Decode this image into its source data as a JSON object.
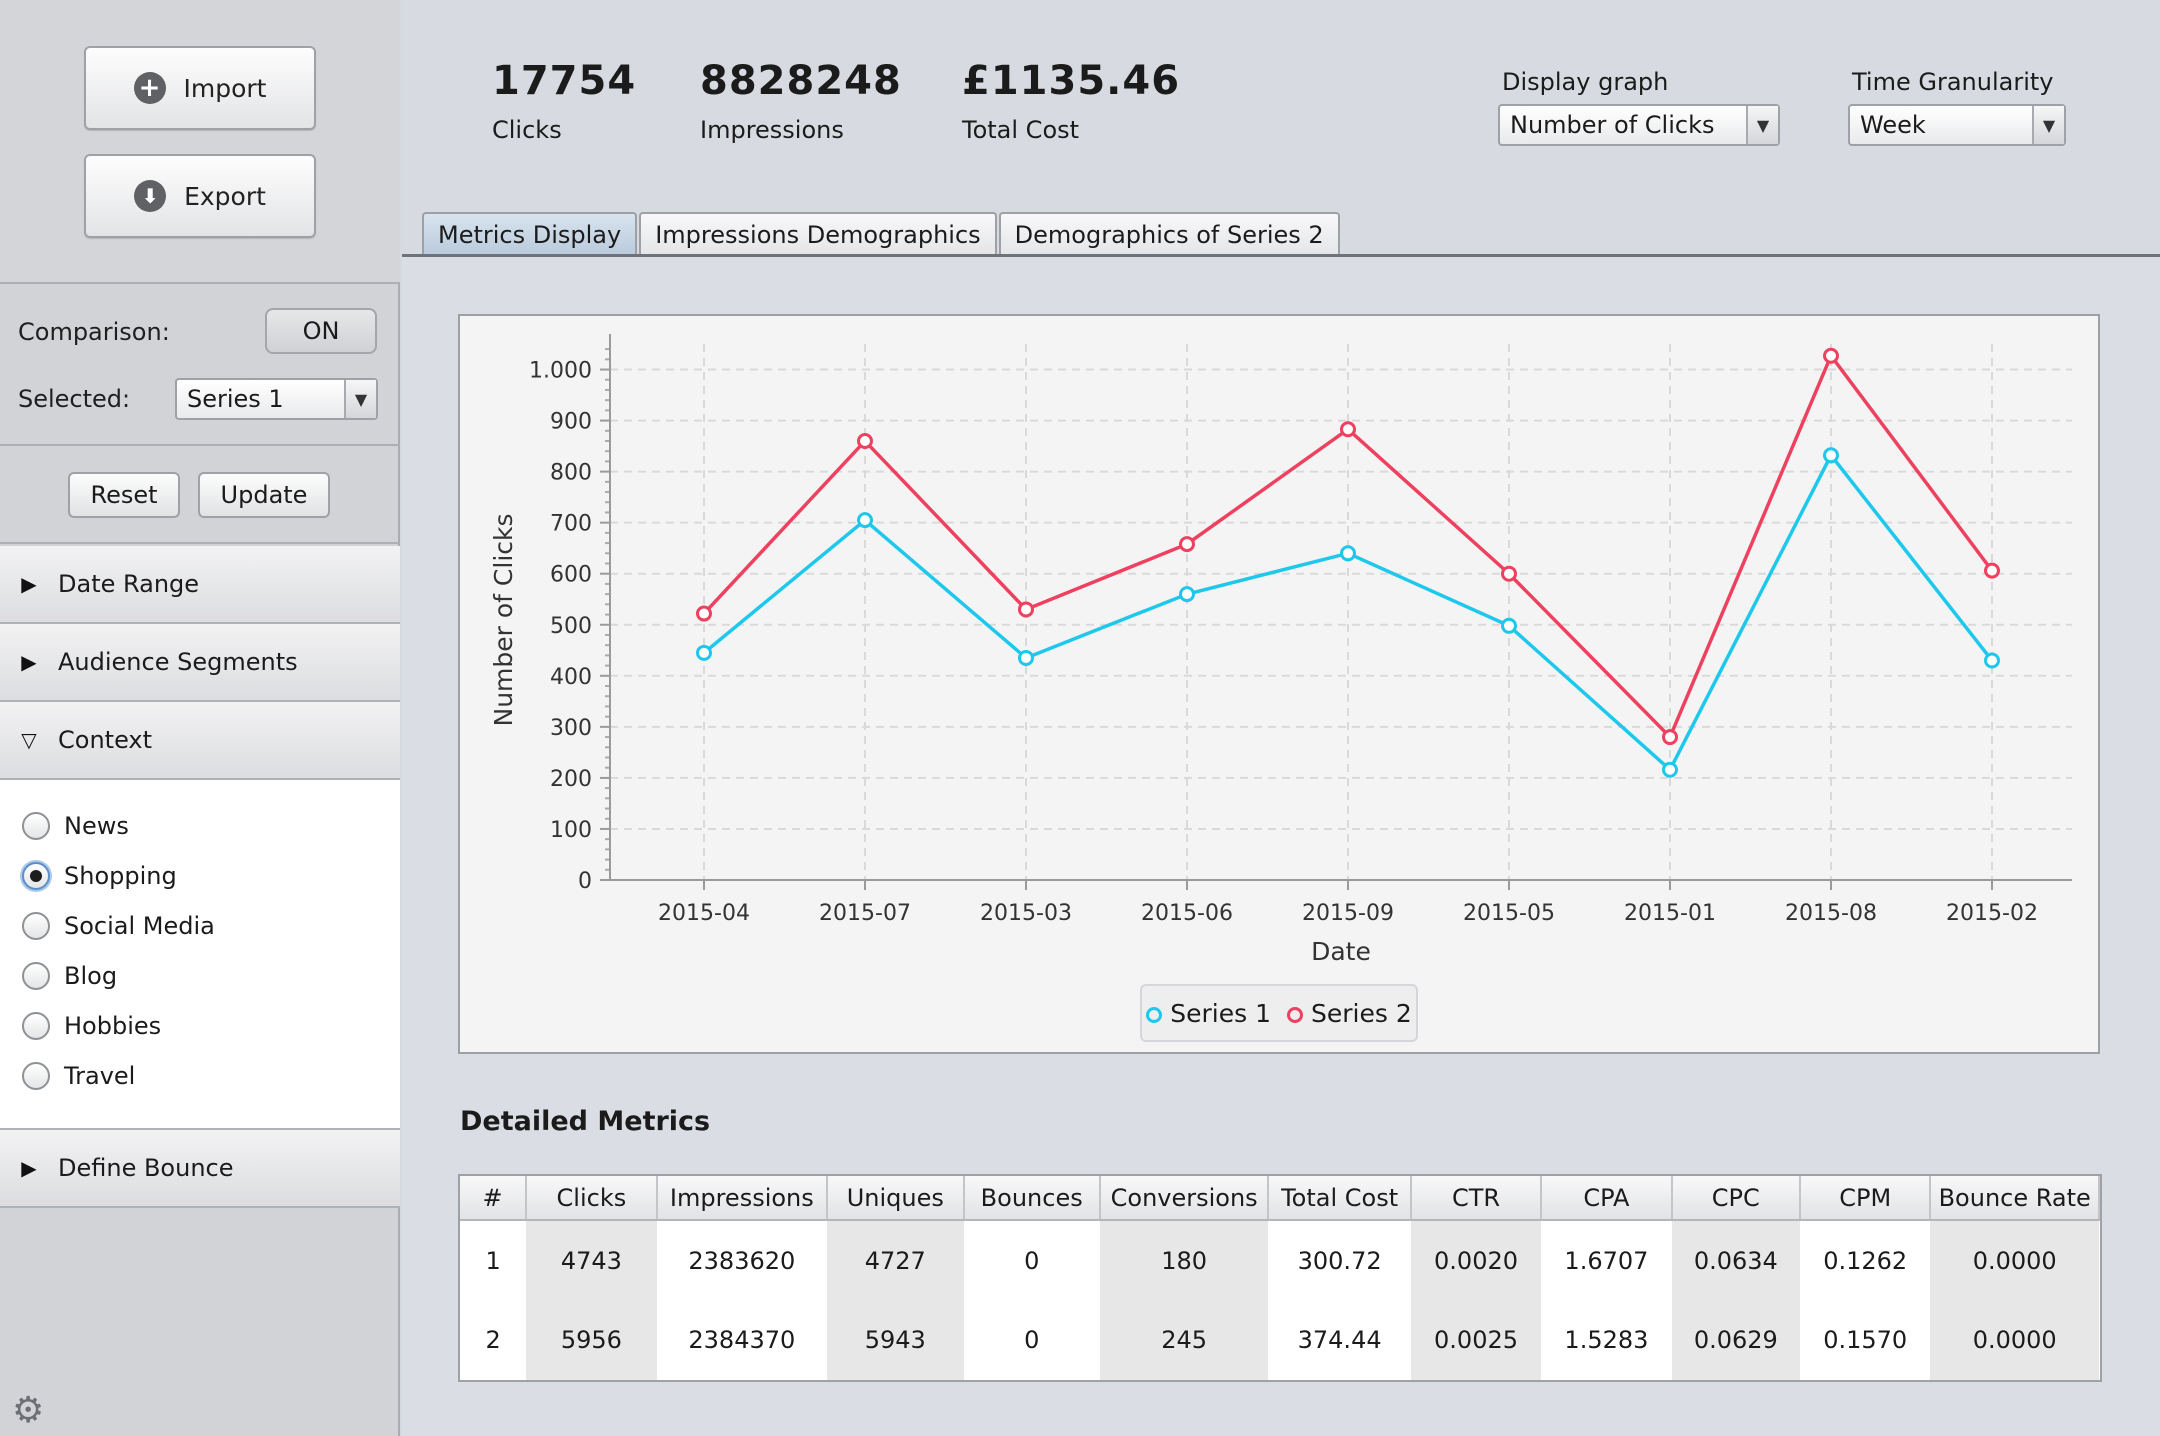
{
  "sidebar": {
    "import_label": "Import",
    "export_label": "Export",
    "comparison_label": "Comparison:",
    "comparison_value": "ON",
    "selected_label": "Selected:",
    "selected_value": "Series 1",
    "reset_label": "Reset",
    "update_label": "Update",
    "accordions": {
      "date_range": "Date Range",
      "audience_segments": "Audience Segments",
      "context": "Context",
      "define_bounce": "Define Bounce"
    },
    "context_options": [
      {
        "label": "News",
        "selected": false
      },
      {
        "label": "Shopping",
        "selected": true
      },
      {
        "label": "Social Media",
        "selected": false
      },
      {
        "label": "Blog",
        "selected": false
      },
      {
        "label": "Hobbies",
        "selected": false
      },
      {
        "label": "Travel",
        "selected": false
      }
    ]
  },
  "header": {
    "stats": [
      {
        "value": "17754",
        "label": "Clicks"
      },
      {
        "value": "8828248",
        "label": "Impressions"
      },
      {
        "value": "£1135.46",
        "label": "Total Cost"
      }
    ],
    "display_graph_label": "Display graph",
    "display_graph_value": "Number of Clicks",
    "granularity_label": "Time Granularity",
    "granularity_value": "Week"
  },
  "tabs": [
    "Metrics Display",
    "Impressions Demographics",
    "Demographics of Series 2"
  ],
  "chart_data": {
    "type": "line",
    "title": "",
    "xlabel": "Date",
    "ylabel": "Number of Clicks",
    "categories": [
      "2015-04",
      "2015-07",
      "2015-03",
      "2015-06",
      "2015-09",
      "2015-05",
      "2015-01",
      "2015-08",
      "2015-02"
    ],
    "ylim": [
      0,
      1050
    ],
    "yticks": [
      0,
      100,
      200,
      300,
      400,
      500,
      600,
      700,
      800,
      900,
      1000
    ],
    "ytick_labels": [
      "0",
      "100",
      "200",
      "300",
      "400",
      "500",
      "600",
      "700",
      "800",
      "900",
      "1.000"
    ],
    "grid": true,
    "legend_position": "bottom",
    "series": [
      {
        "name": "Series 1",
        "color": "#1ec8ec",
        "values": [
          445,
          705,
          435,
          560,
          640,
          498,
          216,
          832,
          430
        ]
      },
      {
        "name": "Series 2",
        "color": "#ee4160",
        "values": [
          522,
          860,
          530,
          658,
          883,
          600,
          280,
          1027,
          606
        ]
      }
    ]
  },
  "metrics": {
    "title": "Detailed Metrics",
    "columns": [
      "#",
      "Clicks",
      "Impressions",
      "Uniques",
      "Bounces",
      "Conversions",
      "Total Cost",
      "CTR",
      "CPA",
      "CPC",
      "CPM",
      "Bounce Rate"
    ],
    "rows": [
      [
        "1",
        "4743",
        "2383620",
        "4727",
        "0",
        "180",
        "300.72",
        "0.0020",
        "1.6707",
        "0.0634",
        "0.1262",
        "0.0000"
      ],
      [
        "2",
        "5956",
        "2384370",
        "5943",
        "0",
        "245",
        "374.44",
        "0.0025",
        "1.5283",
        "0.0629",
        "0.1570",
        "0.0000"
      ]
    ]
  }
}
